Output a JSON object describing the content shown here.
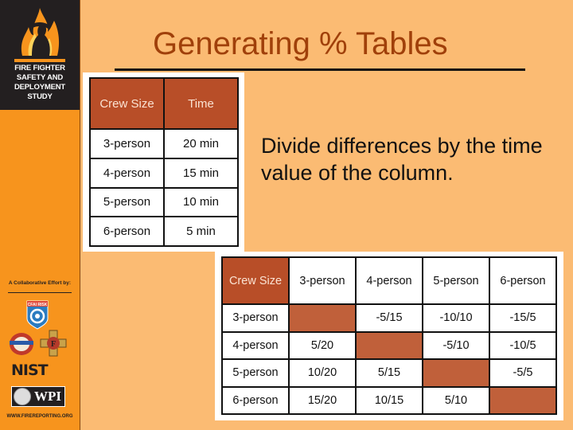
{
  "sidebar": {
    "logo_title_lines": [
      "FIRE FIGHTER",
      "SAFETY AND",
      "DEPLOYMENT",
      "STUDY"
    ],
    "collab_label": "A Collaborative Effort by:",
    "partners": [
      {
        "name": "CFAI RISK",
        "icon": "cfai-risk-logo"
      },
      {
        "name": "IAFC seal",
        "icon": "iafc-seal-logo"
      },
      {
        "name": "IAFF",
        "icon": "iaff-logo"
      },
      {
        "name": "NIST",
        "icon": "nist-logo"
      },
      {
        "name": "WPI",
        "icon": "wpi-logo"
      }
    ],
    "url": "WWW.FIREREPORTING.ORG",
    "colors": {
      "background": "#f7941d",
      "header": "#231f20"
    }
  },
  "slide": {
    "title": "Generating % Tables",
    "body": "Divide differences by the time value of the column.",
    "colors": {
      "background": "#fbbb73",
      "title": "#a0400a",
      "table_header": "#b84e28",
      "table_fill": "#c0603a"
    }
  },
  "time_table": {
    "headers": [
      "Crew Size",
      "Time"
    ],
    "rows": [
      [
        "3-person",
        "20 min"
      ],
      [
        "4-person",
        "15 min"
      ],
      [
        "5-person",
        "10 min"
      ],
      [
        "6-person",
        "5 min"
      ]
    ]
  },
  "pct_table": {
    "headers": [
      "Crew Size",
      "3-person",
      "4-person",
      "5-person",
      "6-person"
    ],
    "rows": [
      [
        "3-person",
        "",
        "-5/15",
        "-10/10",
        "-15/5"
      ],
      [
        "4-person",
        "5/20",
        "",
        "-5/10",
        "-10/5"
      ],
      [
        "5-person",
        "10/20",
        "5/15",
        "",
        "-5/5"
      ],
      [
        "6-person",
        "15/20",
        "10/15",
        "5/10",
        ""
      ]
    ]
  }
}
